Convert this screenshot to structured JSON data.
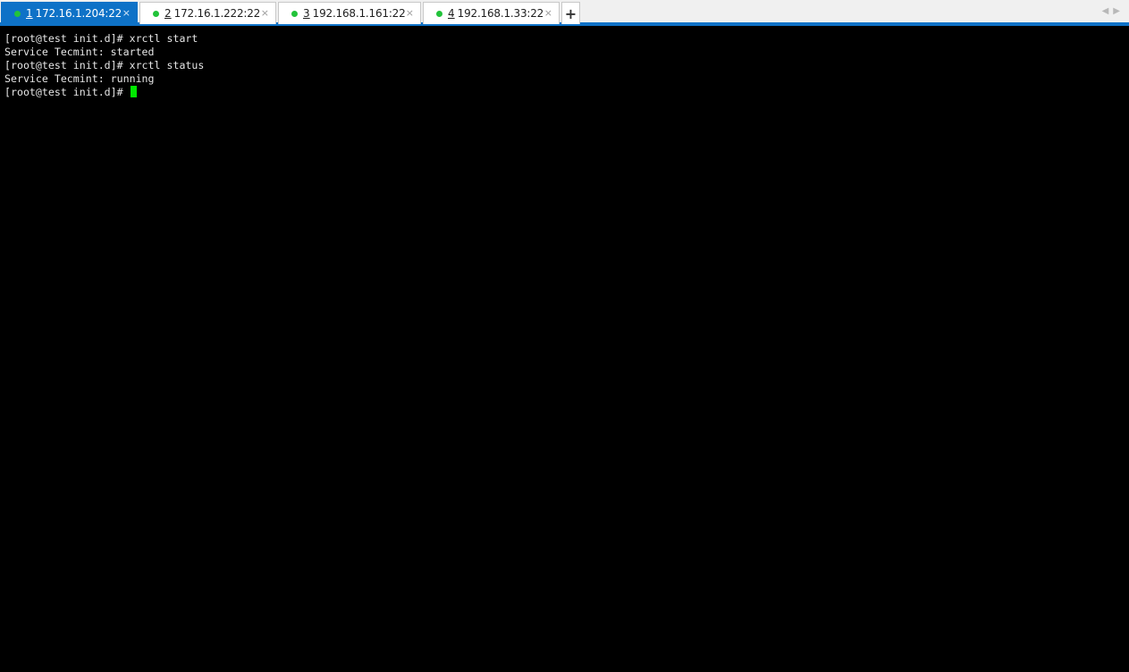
{
  "tabs": [
    {
      "num": "1",
      "label": "172.16.1.204:22",
      "active": true
    },
    {
      "num": "2",
      "label": "172.16.1.222:22",
      "active": false
    },
    {
      "num": "3",
      "label": "192.168.1.161:22",
      "active": false
    },
    {
      "num": "4",
      "label": "192.168.1.33:22",
      "active": false
    }
  ],
  "tab_close_glyph": "×",
  "add_tab_glyph": "+",
  "nav": {
    "left": "◀",
    "right": "▶"
  },
  "colors": {
    "accent": "#0e72c7",
    "status_dot": "#22c33a",
    "cursor": "#00e800",
    "terminal_bg": "#000000",
    "terminal_fg": "#e6e6e6"
  },
  "terminal": {
    "lines": [
      "[root@test init.d]# xrctl start",
      "Service Tecmint: started",
      "[root@test init.d]# xrctl status",
      "Service Tecmint: running",
      "[root@test init.d]# "
    ]
  }
}
